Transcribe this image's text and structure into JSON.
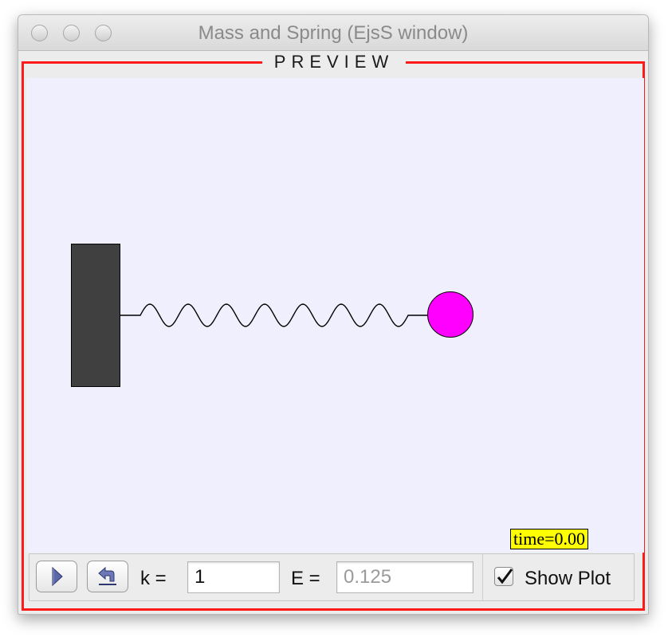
{
  "window": {
    "title": "Mass and Spring (EjsS window)"
  },
  "preview": {
    "label": "PREVIEW"
  },
  "simulation": {
    "time_label": "time=0.00"
  },
  "controls": {
    "play_icon": "play-icon",
    "reset_icon": "reset-icon",
    "k_label": "k =",
    "k_value": "1",
    "e_label": "E =",
    "e_value": "0.125",
    "show_plot_label": "Show Plot",
    "show_plot_checked": true
  },
  "colors": {
    "frame": "#ff1a1a",
    "canvas": "#efeffe",
    "wall": "#404040",
    "ball": "#ff00ff",
    "time_badge": "#ffff00"
  }
}
